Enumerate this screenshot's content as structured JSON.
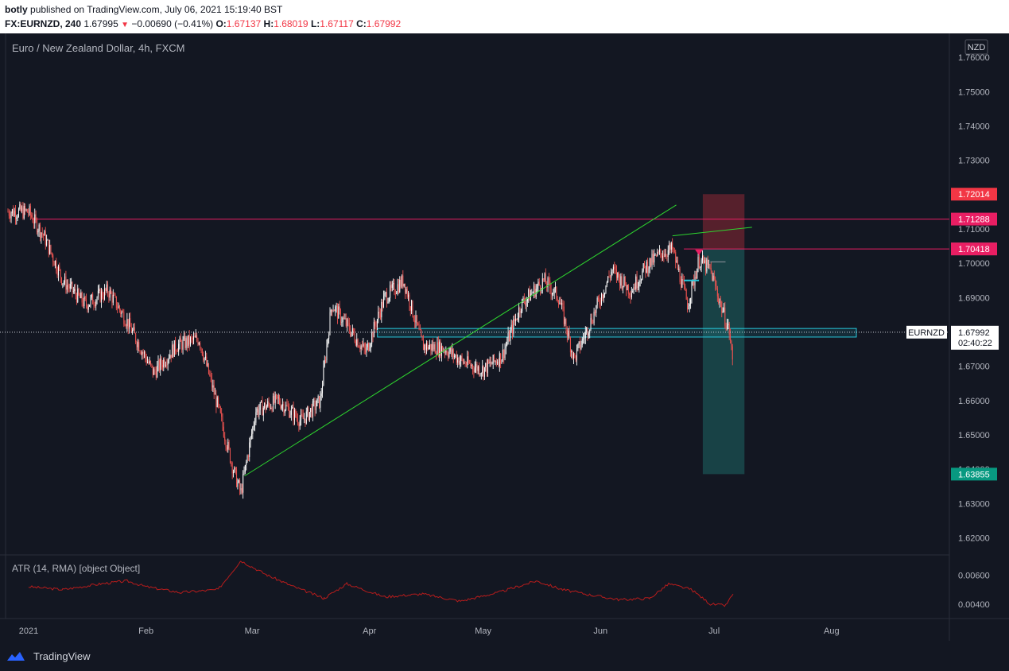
{
  "header": {
    "user": "botly",
    "published_text": "published on TradingView.com, July 06, 2021 15:19:40 BST",
    "symbol_line": "FX:EURNZD, 240",
    "last": "1.67995",
    "change": "−0.00690 (−0.41%)",
    "o_label": "O:",
    "o_value": "1.67137",
    "h_label": "H:",
    "h_value": "1.68019",
    "l_label": "L:",
    "l_value": "1.67117",
    "c_label": "C:",
    "c_value": "1.67992"
  },
  "chart_title": "Euro / New Zealand Dollar, 4h, FXCM",
  "currency_badge": "NZD",
  "indicator_label": "ATR (14, RMA) [object Object]",
  "brand": "TradingView",
  "colors": {
    "background": "#131722",
    "up_candle": "#ffffff",
    "down_candle": "#ef5350",
    "trendline": "#2ed52e",
    "horizontal_line": "#e91e63",
    "zone": "#26c6da",
    "stop_zone": "#f23645",
    "target_zone": "#26a69a",
    "atr_line": "#b71c1c"
  },
  "chart_data": {
    "type": "candlestick",
    "symbol": "EURNZD",
    "interval": "4h",
    "ylim": [
      1.615,
      1.767
    ],
    "y_ticks": [
      "1.76000",
      "1.75000",
      "1.74000",
      "1.73000",
      "1.72000",
      "1.71000",
      "1.70000",
      "1.69000",
      "1.68000",
      "1.67000",
      "1.66000",
      "1.65000",
      "1.64000",
      "1.63000",
      "1.62000"
    ],
    "x_ticks": [
      "2021",
      "Feb",
      "Mar",
      "Apr",
      "May",
      "Jun",
      "Jul",
      "Aug"
    ],
    "price_path": [
      [
        "2021-01-01",
        1.715
      ],
      [
        "2021-01-05",
        1.708
      ],
      [
        "2021-01-10",
        1.695
      ],
      [
        "2021-01-16",
        1.688
      ],
      [
        "2021-01-22",
        1.692
      ],
      [
        "2021-01-27",
        1.683
      ],
      [
        "2021-02-03",
        1.668
      ],
      [
        "2021-02-09",
        1.676
      ],
      [
        "2021-02-15",
        1.678
      ],
      [
        "2021-02-20",
        1.658
      ],
      [
        "2021-02-24",
        1.64
      ],
      [
        "2021-02-26",
        1.633
      ],
      [
        "2021-03-02",
        1.657
      ],
      [
        "2021-03-08",
        1.66
      ],
      [
        "2021-03-14",
        1.654
      ],
      [
        "2021-03-19",
        1.66
      ],
      [
        "2021-03-22",
        1.688
      ],
      [
        "2021-03-26",
        1.682
      ],
      [
        "2021-03-31",
        1.674
      ],
      [
        "2021-04-05",
        1.69
      ],
      [
        "2021-04-10",
        1.695
      ],
      [
        "2021-04-15",
        1.676
      ],
      [
        "2021-04-21",
        1.675
      ],
      [
        "2021-04-26",
        1.671
      ],
      [
        "2021-05-01",
        1.669
      ],
      [
        "2021-05-06",
        1.673
      ],
      [
        "2021-05-11",
        1.688
      ],
      [
        "2021-05-17",
        1.695
      ],
      [
        "2021-05-21",
        1.69
      ],
      [
        "2021-05-25",
        1.672
      ],
      [
        "2021-05-29",
        1.682
      ],
      [
        "2021-06-04",
        1.698
      ],
      [
        "2021-06-09",
        1.692
      ],
      [
        "2021-06-13",
        1.699
      ],
      [
        "2021-06-17",
        1.703
      ],
      [
        "2021-06-20",
        1.704
      ],
      [
        "2021-06-24",
        1.688
      ],
      [
        "2021-06-27",
        1.701
      ],
      [
        "2021-06-30",
        1.698
      ],
      [
        "2021-07-03",
        1.687
      ],
      [
        "2021-07-05",
        1.68
      ],
      [
        "2021-07-06",
        1.67
      ]
    ],
    "last_price": "1.67992",
    "countdown": "02:40:22",
    "price_labels": [
      {
        "value": "1.72014",
        "role": "stop"
      },
      {
        "value": "1.71288",
        "role": "resistance"
      },
      {
        "value": "1.70419",
        "role": "entry"
      },
      {
        "value": "1.70418",
        "role": "level"
      },
      {
        "value": "1.63855",
        "role": "target"
      }
    ],
    "horizontal_levels": [
      1.71288,
      1.70418
    ],
    "support_zone": [
      1.6785,
      1.681
    ],
    "trendlines": [
      {
        "from": [
          "2021-02-27",
          1.638
        ],
        "to": [
          "2021-06-21",
          1.717
        ]
      },
      {
        "from": [
          "2021-06-20",
          1.708
        ],
        "to": [
          "2021-07-11",
          1.7105
        ]
      }
    ],
    "position": {
      "type": "short",
      "entry": 1.70419,
      "stop": 1.72014,
      "target": 1.63855
    },
    "atr": {
      "name": "ATR (14, RMA)",
      "y_ticks": [
        "0.00600",
        "0.00400"
      ],
      "ylim": [
        0.003,
        0.0074
      ],
      "path": [
        [
          "2021-01-01",
          0.0052
        ],
        [
          "2021-01-10",
          0.005
        ],
        [
          "2021-01-20",
          0.0054
        ],
        [
          "2021-01-27",
          0.0056
        ],
        [
          "2021-02-01",
          0.0052
        ],
        [
          "2021-02-10",
          0.0048
        ],
        [
          "2021-02-20",
          0.005
        ],
        [
          "2021-02-26",
          0.007
        ],
        [
          "2021-03-05",
          0.006
        ],
        [
          "2021-03-12",
          0.0052
        ],
        [
          "2021-03-20",
          0.0044
        ],
        [
          "2021-03-26",
          0.0054
        ],
        [
          "2021-04-05",
          0.0045
        ],
        [
          "2021-04-15",
          0.0047
        ],
        [
          "2021-04-25",
          0.0042
        ],
        [
          "2021-05-05",
          0.0048
        ],
        [
          "2021-05-15",
          0.0056
        ],
        [
          "2021-05-22",
          0.005
        ],
        [
          "2021-05-30",
          0.0046
        ],
        [
          "2021-06-06",
          0.0043
        ],
        [
          "2021-06-14",
          0.0044
        ],
        [
          "2021-06-19",
          0.0054
        ],
        [
          "2021-06-25",
          0.005
        ],
        [
          "2021-06-30",
          0.004
        ],
        [
          "2021-07-04",
          0.0039
        ],
        [
          "2021-07-06",
          0.0047
        ]
      ]
    }
  }
}
